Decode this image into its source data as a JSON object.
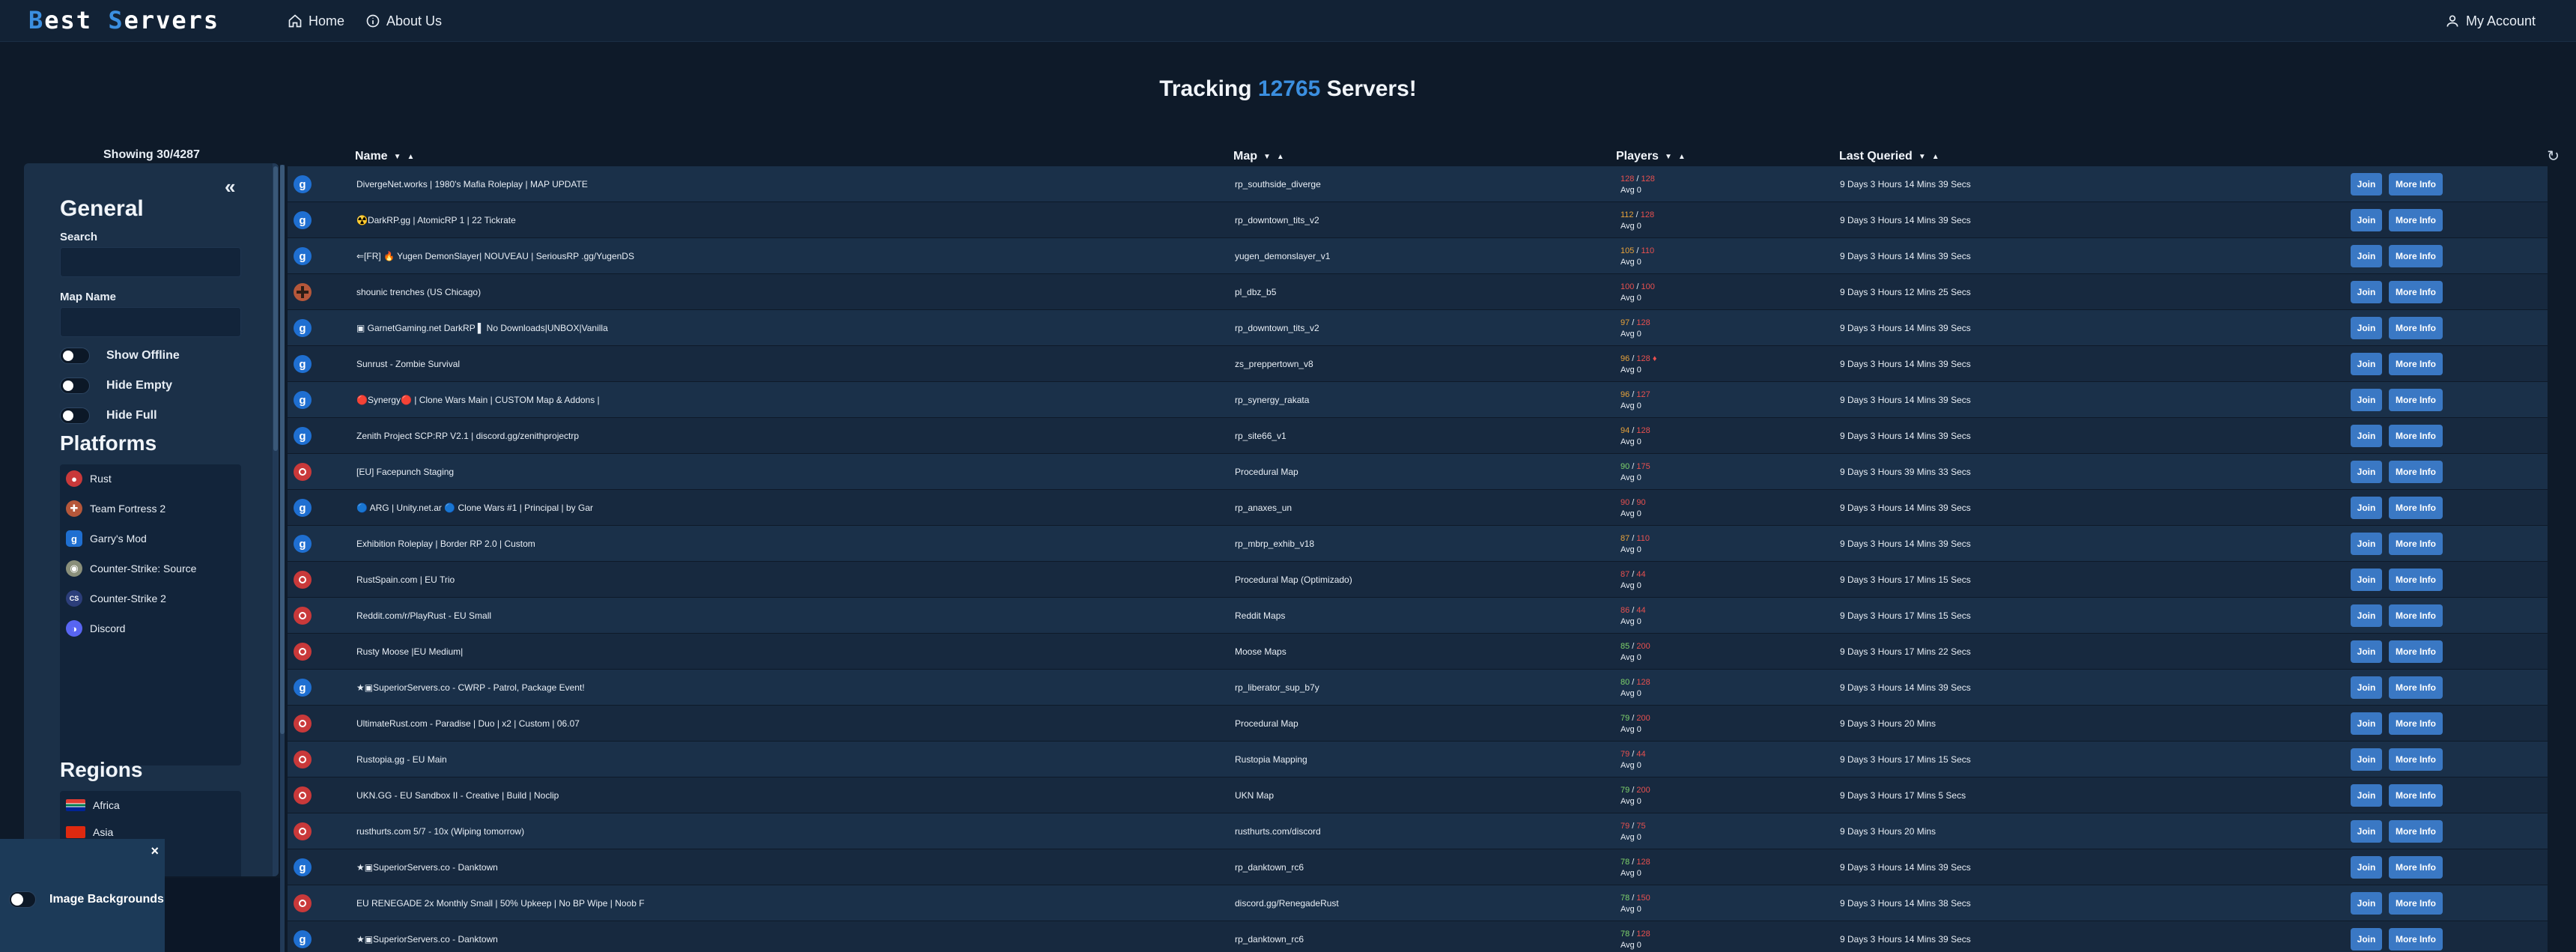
{
  "brand": {
    "word1_first": "B",
    "word1_rest": "est",
    "word2_first": "S",
    "word2_rest": "ervers"
  },
  "nav": {
    "home": "Home",
    "about": "About Us",
    "account": "My Account"
  },
  "tracking": {
    "prefix": "Tracking ",
    "count": "12765",
    "suffix": " Servers!"
  },
  "showing": "Showing 30/4287",
  "sidebar": {
    "collapse": "«",
    "general": "General",
    "search_label": "Search",
    "map_label": "Map Name",
    "toggles": [
      "Show Offline",
      "Hide Empty",
      "Hide Full"
    ],
    "platforms_title": "Platforms",
    "platforms": [
      {
        "label": "Rust",
        "icon": "rust-icon",
        "color": "#c9393a"
      },
      {
        "label": "Team Fortress 2",
        "icon": "tf2-icon",
        "color": "#b5573a"
      },
      {
        "label": "Garry's Mod",
        "icon": "gmod-icon",
        "color": "#1f6fd1"
      },
      {
        "label": "Counter-Strike: Source",
        "icon": "css-icon",
        "color": "#8a8f7a"
      },
      {
        "label": "Counter-Strike 2",
        "icon": "cs2-icon",
        "color": "#2c3e7a"
      },
      {
        "label": "Discord",
        "icon": "discord-icon",
        "color": "#5865f2"
      }
    ],
    "regions_title": "Regions",
    "regions": [
      {
        "label": "Africa",
        "icon": "africa-flag-icon"
      },
      {
        "label": "Asia",
        "icon": "asia-flag-icon"
      }
    ]
  },
  "image_bg": {
    "label": "Image Backgrounds",
    "close": "×"
  },
  "table": {
    "headers": {
      "name": "Name",
      "map": "Map",
      "players": "Players",
      "last": "Last Queried"
    },
    "refresh": "↻",
    "join": "Join",
    "more": "More Info",
    "rows": [
      {
        "game": "g",
        "name": "DivergeNet.works | 1980's Mafia Roleplay | MAP UPDATE",
        "map": "rp_southside_diverge",
        "cur": "128",
        "max": "128",
        "avg": "Avg 0",
        "last": "9 Days 3 Hours 14 Mins 39 Secs"
      },
      {
        "game": "g",
        "name": "☢️DarkRP.gg | AtomicRP 1 | 22 Tickrate",
        "map": "rp_downtown_tits_v2",
        "cur": "112",
        "max": "128",
        "avg": "Avg 0",
        "last": "9 Days 3 Hours 14 Mins 39 Secs"
      },
      {
        "game": "g",
        "name": "⇐[FR] 🔥 Yugen DemonSlayer| NOUVEAU | SeriousRP .gg/YugenDS",
        "map": "yugen_demonslayer_v1",
        "cur": "105",
        "max": "110",
        "avg": "Avg 0",
        "last": "9 Days 3 Hours 14 Mins 39 Secs"
      },
      {
        "game": "t",
        "name": "shounic trenches (US Chicago)",
        "map": "pl_dbz_b5",
        "cur": "100",
        "max": "100",
        "avg": "Avg 0",
        "last": "9 Days 3 Hours 12 Mins 25 Secs"
      },
      {
        "game": "g",
        "name": "▣ GarnetGaming.net DarkRP ▌ No Downloads|UNBOX|Vanilla",
        "map": "rp_downtown_tits_v2",
        "cur": "97",
        "max": "128",
        "avg": "Avg 0",
        "last": "9 Days 3 Hours 14 Mins 39 Secs"
      },
      {
        "game": "g",
        "name": "Sunrust - Zombie Survival",
        "map": "zs_preppertown_v8",
        "cur": "96",
        "max": "128 ♦",
        "avg": "Avg 0",
        "last": "9 Days 3 Hours 14 Mins 39 Secs"
      },
      {
        "game": "g",
        "name": "🔴Synergy🔴 | Clone Wars Main | CUSTOM Map & Addons |",
        "map": "rp_synergy_rakata",
        "cur": "96",
        "max": "127",
        "avg": "Avg 0",
        "last": "9 Days 3 Hours 14 Mins 39 Secs"
      },
      {
        "game": "g",
        "name": "Zenith Project SCP:RP V2.1 | discord.gg/zenithprojectrp",
        "map": "rp_site66_v1",
        "cur": "94",
        "max": "128",
        "avg": "Avg 0",
        "last": "9 Days 3 Hours 14 Mins 39 Secs"
      },
      {
        "game": "r",
        "name": "[EU] Facepunch Staging",
        "map": "Procedural Map",
        "cur": "90",
        "max": "175",
        "avg": "Avg 0",
        "last": "9 Days 3 Hours 39 Mins 33 Secs"
      },
      {
        "game": "g",
        "name": "🔵 ARG | Unity.net.ar 🔵 Clone Wars #1 | Principal | by Gar",
        "map": "rp_anaxes_un",
        "cur": "90",
        "max": "90",
        "avg": "Avg 0",
        "last": "9 Days 3 Hours 14 Mins 39 Secs"
      },
      {
        "game": "g",
        "name": "Exhibition Roleplay | Border RP 2.0 | Custom",
        "map": "rp_mbrp_exhib_v18",
        "cur": "87",
        "max": "110",
        "avg": "Avg 0",
        "last": "9 Days 3 Hours 14 Mins 39 Secs"
      },
      {
        "game": "r",
        "name": "RustSpain.com | EU Trio",
        "map": "Procedural Map (Optimizado)",
        "cur": "87",
        "max": "44",
        "avg": "Avg 0",
        "last": "9 Days 3 Hours 17 Mins 15 Secs"
      },
      {
        "game": "r",
        "name": "Reddit.com/r/PlayRust - EU Small",
        "map": "Reddit Maps",
        "cur": "86",
        "max": "44",
        "avg": "Avg 0",
        "last": "9 Days 3 Hours 17 Mins 15 Secs"
      },
      {
        "game": "r",
        "name": "Rusty Moose |EU Medium|",
        "map": "Moose Maps",
        "cur": "85",
        "max": "200",
        "avg": "Avg 0",
        "last": "9 Days 3 Hours 17 Mins 22 Secs"
      },
      {
        "game": "g",
        "name": "★▣SuperiorServers.co - CWRP - Patrol, Package Event!",
        "map": "rp_liberator_sup_b7y",
        "cur": "80",
        "max": "128",
        "avg": "Avg 0",
        "last": "9 Days 3 Hours 14 Mins 39 Secs"
      },
      {
        "game": "r",
        "name": "UltimateRust.com - Paradise | Duo | x2 | Custom | 06.07",
        "map": "Procedural Map",
        "cur": "79",
        "max": "200",
        "avg": "Avg 0",
        "last": "9 Days 3 Hours 20 Mins"
      },
      {
        "game": "r",
        "name": "Rustopia.gg - EU Main",
        "map": "Rustopia Mapping",
        "cur": "79",
        "max": "44",
        "avg": "Avg 0",
        "last": "9 Days 3 Hours 17 Mins 15 Secs"
      },
      {
        "game": "r",
        "name": "UKN.GG - EU Sandbox II - Creative | Build | Noclip",
        "map": "UKN Map",
        "cur": "79",
        "max": "200",
        "avg": "Avg 0",
        "last": "9 Days 3 Hours 17 Mins 5 Secs"
      },
      {
        "game": "r",
        "name": "rusthurts.com 5/7 - 10x (Wiping tomorrow)",
        "map": "rusthurts.com/discord",
        "cur": "79",
        "max": "75",
        "avg": "Avg 0",
        "last": "9 Days 3 Hours 20 Mins"
      },
      {
        "game": "g",
        "name": "★▣SuperiorServers.co - Danktown",
        "map": "rp_danktown_rc6",
        "cur": "78",
        "max": "128",
        "avg": "Avg 0",
        "last": "9 Days 3 Hours 14 Mins 39 Secs"
      },
      {
        "game": "r",
        "name": "EU RENEGADE 2x Monthly Small | 50% Upkeep | No BP Wipe | Noob F",
        "map": "discord.gg/RenegadeRust",
        "cur": "78",
        "max": "150",
        "avg": "Avg 0",
        "last": "9 Days 3 Hours 14 Mins 38 Secs"
      },
      {
        "game": "g",
        "name": "★▣SuperiorServers.co - Danktown",
        "map": "rp_danktown_rc6",
        "cur": "78",
        "max": "128",
        "avg": "Avg 0",
        "last": "9 Days 3 Hours 14 Mins 39 Secs"
      }
    ]
  },
  "colors": {
    "accent": "#3b8fe0",
    "full": "#e8504f",
    "button": "#3a78c4",
    "background": "#0e1a29"
  }
}
